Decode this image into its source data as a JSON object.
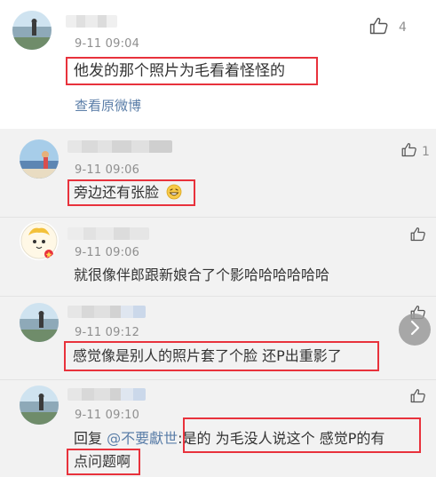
{
  "main": {
    "time": "9-11 09:04",
    "text": "他发的那个照片为毛看着怪怪的",
    "likes": "4",
    "view_original": "查看原微博"
  },
  "replies": [
    {
      "time": "9-11 09:06",
      "text": "旁边还有张脸",
      "emoji": "grinning-face-emoji",
      "likes": "1"
    },
    {
      "time": "9-11 09:06",
      "text": "就很像伴郎跟新娘合了个影哈哈哈哈哈哈"
    },
    {
      "time": "9-11 09:12",
      "text": "感觉像是别人的照片套了个脸 还P出重影了"
    },
    {
      "time": "9-11 09:10",
      "prefix": "回复",
      "mention": "@不要獻世",
      "colon": ":",
      "text_line1": "是的 为毛没人说这个 感觉P的有",
      "text_line2": "点问题啊"
    }
  ],
  "colors": {
    "highlight": "#e8323c",
    "link": "#5b7ea8",
    "reply_background": "#f2f2f2",
    "time": "#8f8f8f"
  },
  "icons": {
    "like": "thumbs-up-icon",
    "next": "chevron-right-icon"
  }
}
